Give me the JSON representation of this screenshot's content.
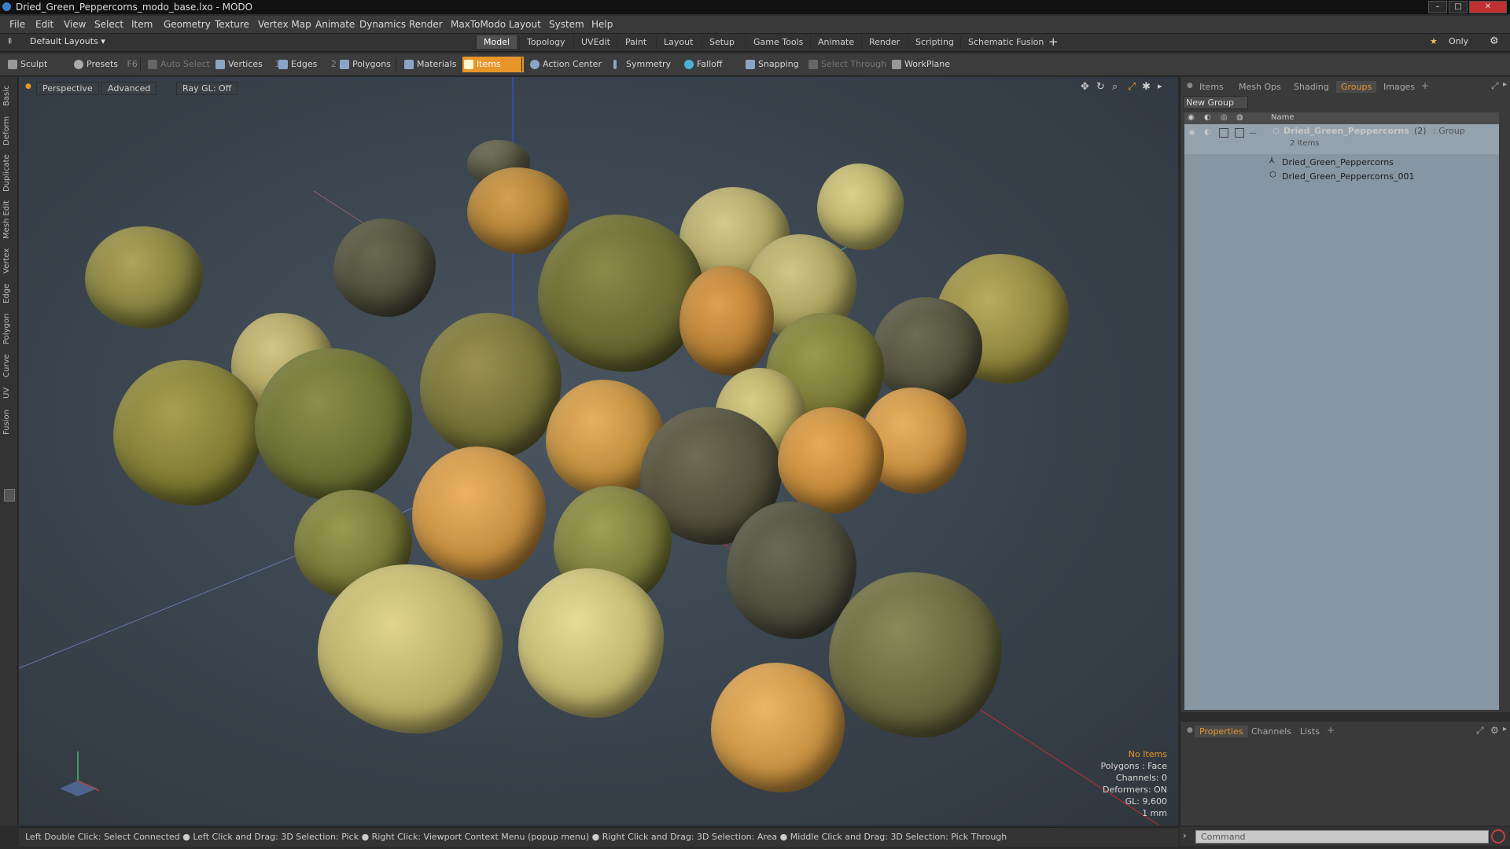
{
  "window": {
    "title": "Dried_Green_Peppercorns_modo_base.lxo - MODO"
  },
  "menu": [
    "File",
    "Edit",
    "View",
    "Select",
    "Item",
    "Geometry",
    "Texture",
    "Vertex Map",
    "Animate",
    "Dynamics",
    "Render",
    "MaxToModo",
    "Layout",
    "System",
    "Help"
  ],
  "layout_selector": "Default Layouts",
  "layout_tabs": [
    "Model",
    "Topology",
    "UVEdit",
    "Paint",
    "Layout",
    "Setup",
    "Game Tools",
    "Animate",
    "Render",
    "Scripting",
    "Schematic Fusion"
  ],
  "active_layout_tab": "Model",
  "only_label": "Only",
  "toolbar": {
    "sculpt": "Sculpt",
    "presets": "Presets",
    "presets_key": "F6",
    "auto_select": "Auto Select",
    "vertices": "Vertices",
    "vertices_count": "1",
    "edges": "Edges",
    "edges_count": "2",
    "polygons": "Polygons",
    "materials": "Materials",
    "items": "Items",
    "action_center": "Action Center",
    "symmetry": "Symmetry",
    "falloff": "Falloff",
    "snapping": "Snapping",
    "select_through": "Select Through",
    "workplane": "WorkPlane"
  },
  "left_tabs": [
    "Basic",
    "Deform",
    "Duplicate",
    "Mesh Edit",
    "Vertex",
    "Edge",
    "Polygon",
    "Curve",
    "UV",
    "Fusion"
  ],
  "viewport": {
    "view": "Perspective",
    "shading": "Advanced",
    "raygl": "Ray GL: Off",
    "info": {
      "selection": "No Items",
      "polygons": "Polygons : Face",
      "channels": "Channels: 0",
      "deformers": "Deformers: ON",
      "gl": "GL: 9,600",
      "unit": "1 mm"
    }
  },
  "right_panel": {
    "tabs": [
      "Items",
      "Mesh Ops",
      "Shading",
      "Groups",
      "Images"
    ],
    "active_tab": "Groups",
    "new_group": "New Group",
    "column_name": "Name",
    "group": {
      "name": "Dried_Green_Peppercorns",
      "count": "(2)",
      "type": ": Group",
      "sub": "2 Items"
    },
    "items": [
      "Dried_Green_Peppercorns",
      "Dried_Green_Peppercorns_001"
    ]
  },
  "bottom_panel": {
    "tabs": [
      "Properties",
      "Channels",
      "Lists"
    ],
    "active_tab": "Properties"
  },
  "status_bar": "Left Double Click: Select Connected ● Left Click and Drag: 3D Selection: Pick ● Right Click: Viewport Context Menu (popup menu) ● Right Click and Drag: 3D Selection: Area ● Middle Click and Drag: 3D Selection: Pick Through",
  "command_placeholder": "Command",
  "colors": {
    "accent": "#e8952a",
    "groups_bg": "#8796a3"
  }
}
